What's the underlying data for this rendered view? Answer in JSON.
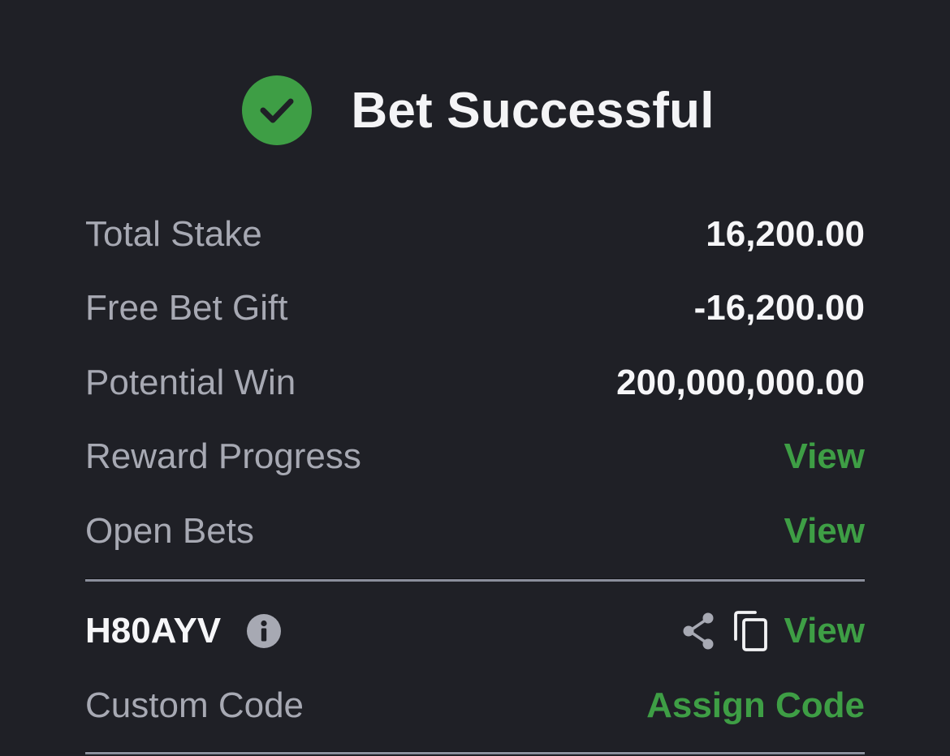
{
  "header": {
    "title": "Bet Successful",
    "icon": "check-circle-icon",
    "icon_color": "#3e9e45"
  },
  "summary": {
    "total_stake": {
      "label": "Total Stake",
      "value": "16,200.00"
    },
    "free_bet_gift": {
      "label": "Free Bet Gift",
      "value": "-16,200.00"
    },
    "potential_win": {
      "label": "Potential Win",
      "value": "200,000,000.00"
    },
    "reward_progress": {
      "label": "Reward Progress",
      "link": "View"
    },
    "open_bets": {
      "label": "Open Bets",
      "link": "View"
    }
  },
  "booking": {
    "code": "H80AYV",
    "info_icon": "info-icon",
    "share_icon": "share-icon",
    "copy_icon": "copy-icon",
    "view_label": "View"
  },
  "custom_code": {
    "label": "Custom Code",
    "action": "Assign Code"
  },
  "colors": {
    "background": "#1f2026",
    "accent_green": "#3e9e45",
    "label_gray": "#a7a9b3",
    "value_white": "#f6f6f8"
  }
}
